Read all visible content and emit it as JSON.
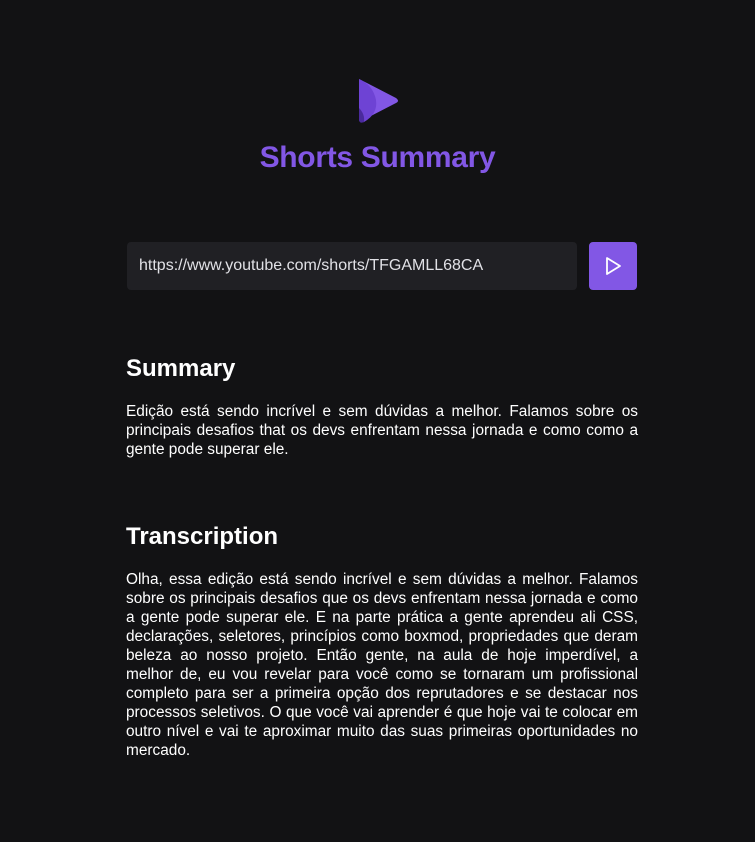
{
  "header": {
    "logo_icon": "play-logo-icon",
    "title": "Shorts Summary"
  },
  "form": {
    "url_value": "https://www.youtube.com/shorts/TFGAMLL68CA",
    "submit_icon": "play-icon"
  },
  "summary": {
    "title": "Summary",
    "text": "Edição está sendo incrível e sem dúvidas a melhor. Falamos sobre os principais desafios that os devs enfrentam nessa jornada e como como a gente pode superar ele."
  },
  "transcription": {
    "title": "Transcription",
    "text": "Olha, essa edição está sendo incrível e sem dúvidas a melhor. Falamos sobre os principais desafios que os devs enfrentam nessa jornada e como a gente pode superar ele. E na parte prática a gente aprendeu ali CSS, declarações, seletores, princípios como boxmod, propriedades que deram beleza ao nosso projeto. Então gente, na aula de hoje imperdível, a melhor de, eu vou revelar para você como se tornaram um profissional completo para ser a primeira opção dos reprutadores e se destacar nos processos seletivos. O que você vai aprender é que hoje vai te colocar em outro nível e vai te aproximar muito das suas primeiras oportunidades no mercado."
  },
  "colors": {
    "background": "#121214",
    "accent": "#8257e5",
    "input_background": "#202024",
    "text": "#ffffff"
  }
}
